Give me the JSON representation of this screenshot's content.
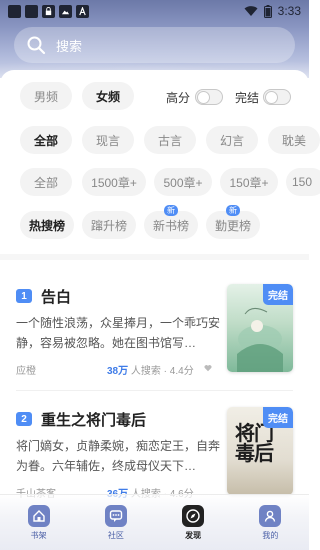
{
  "status_bar": {
    "time": "3:33"
  },
  "search": {
    "placeholder": "搜索"
  },
  "gender_tabs": [
    {
      "label": "男频",
      "active": false
    },
    {
      "label": "女频",
      "active": true
    }
  ],
  "toggles": [
    {
      "label": "高分",
      "on": false
    },
    {
      "label": "完结",
      "on": false
    }
  ],
  "category_filters": [
    {
      "label": "全部",
      "active": true
    },
    {
      "label": "现言",
      "active": false
    },
    {
      "label": "古言",
      "active": false
    },
    {
      "label": "幻言",
      "active": false
    },
    {
      "label": "耽美",
      "active": false
    }
  ],
  "length_filters": [
    {
      "label": "全部"
    },
    {
      "label": "1500章+"
    },
    {
      "label": "500章+"
    },
    {
      "label": "150章+"
    },
    {
      "label": "150"
    }
  ],
  "rank_tabs": [
    {
      "label": "热搜榜",
      "active": true,
      "badge": ""
    },
    {
      "label": "蹿升榜",
      "active": false,
      "badge": ""
    },
    {
      "label": "新书榜",
      "active": false,
      "badge": "新"
    },
    {
      "label": "勤更榜",
      "active": false,
      "badge": "新"
    }
  ],
  "books": [
    {
      "rank": "1",
      "title": "告白",
      "description": "一个随性浪荡，众星捧月，一个乖巧安静，容易被忽略。她在图书馆写…",
      "author": "应橙",
      "readers": "38万",
      "readers_suffix": "人搜索 · 4.4分",
      "badge": "完结",
      "cover_colors": [
        "#cfe7d6",
        "#7fb99a"
      ]
    },
    {
      "rank": "2",
      "title": "重生之将门毒后",
      "description": "将门嫡女，贞静柔婉，痴恋定王，自奔为眷。六年辅佐，终成母仪天下…",
      "author": "千山茶客",
      "readers": "36万",
      "readers_suffix": "人搜索 · 4.6分",
      "badge": "完结",
      "cover_art": "将门毒后",
      "cover_colors": [
        "#e6e1d6",
        "#bfb6a4"
      ]
    }
  ],
  "bottom_nav": [
    {
      "label": "书架",
      "icon": "bookshelf-icon",
      "active": false
    },
    {
      "label": "社区",
      "icon": "community-icon",
      "active": false
    },
    {
      "label": "发现",
      "icon": "discover-icon",
      "active": true
    },
    {
      "label": "我的",
      "icon": "profile-icon",
      "active": false
    }
  ],
  "colors": {
    "accent": "#4f8df5",
    "header_top": "#6c79a8"
  }
}
